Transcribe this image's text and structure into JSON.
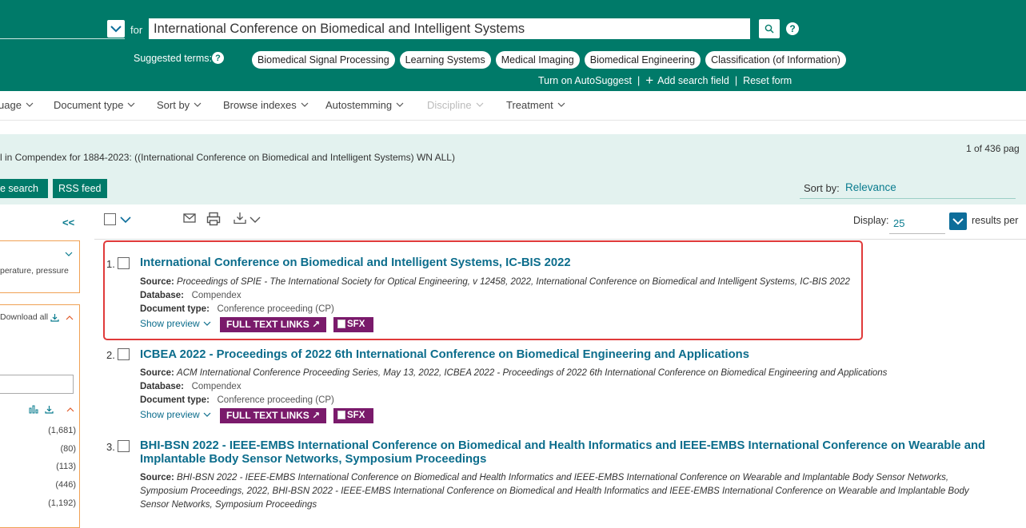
{
  "search": {
    "for_label": "for",
    "query": "International Conference on Biomedical and Intelligent Systems",
    "help_icon": "?"
  },
  "suggested": {
    "label": "Suggested terms:",
    "terms": [
      "Biomedical Signal Processing",
      "Learning Systems",
      "Medical Imaging",
      "Biomedical Engineering",
      "Classification (of Information)"
    ]
  },
  "form_links": {
    "autosuggest": "Turn on AutoSuggest",
    "add_field": "Add search field",
    "reset": "Reset form",
    "separator": "|"
  },
  "filters": [
    "uage",
    "Document type",
    "Sort by",
    "Browse indexes",
    "Autostemming",
    "Discipline",
    "Treatment"
  ],
  "results_header": {
    "query_summary": "l in Compendex for 1884-2023: ((International Conference on Biomedical and Intelligent Systems) WN ALL)",
    "page_count": "1 of 436 pag",
    "save_search": "e search",
    "rss_feed": "RSS feed",
    "sort_label": "Sort by:",
    "sort_value": "Relevance"
  },
  "sidebar": {
    "collapse": "<<",
    "panel1_text": "perature, pressure",
    "download_all": "Download all",
    "counts": [
      "(1,681)",
      "(80)",
      "(113)",
      "(446)",
      "(1,192)"
    ]
  },
  "toolbar": {
    "display_label": "Display:",
    "display_value": "25",
    "per_page": "results per"
  },
  "results": [
    {
      "num": "1.",
      "title": "International Conference on Biomedical and Intelligent Systems, IC-BIS 2022",
      "source_label": "Source:",
      "source": "Proceedings of SPIE - The International Society for Optical Engineering, v 12458, 2022, International Conference on Biomedical and Intelligent Systems, IC-BIS 2022",
      "database_label": "Database:",
      "database": "Compendex",
      "doctype_label": "Document type:",
      "doctype": "Conference proceeding (CP)",
      "preview": "Show preview",
      "ftl": "FULL TEXT LINKS",
      "sfx": "SFX"
    },
    {
      "num": "2.",
      "title": "ICBEA 2022 - Proceedings of 2022 6th International Conference on Biomedical Engineering and Applications",
      "source_label": "Source:",
      "source": "ACM International Conference Proceeding Series, May 13, 2022, ICBEA 2022 - Proceedings of 2022 6th International Conference on Biomedical Engineering and Applications",
      "database_label": "Database:",
      "database": "Compendex",
      "doctype_label": "Document type:",
      "doctype": "Conference proceeding (CP)",
      "preview": "Show preview",
      "ftl": "FULL TEXT LINKS",
      "sfx": "SFX"
    },
    {
      "num": "3.",
      "title": "BHI-BSN 2022 - IEEE-EMBS International Conference on Biomedical and Health Informatics and IEEE-EMBS International Conference on Wearable and Implantable Body Sensor Networks, Symposium Proceedings",
      "source_label": "Source:",
      "source": "BHI-BSN 2022 - IEEE-EMBS International Conference on Biomedical and Health Informatics and IEEE-EMBS International Conference on Wearable and Implantable Body Sensor Networks, Symposium Proceedings, 2022, BHI-BSN 2022 - IEEE-EMBS International Conference on Biomedical and Health Informatics and IEEE-EMBS International Conference on Wearable and Implantable Body Sensor Networks, Symposium Proceedings"
    }
  ],
  "colors": {
    "brand_green": "#007a69",
    "light_band": "#e3f2ef",
    "link_blue": "#0c6d8c",
    "fulltext_purple": "#7a1a6b",
    "highlight_red": "#e03a3a",
    "facet_orange": "#f0a154"
  },
  "icons": [
    "chevron-down-icon",
    "search-icon",
    "help-icon",
    "plus-icon",
    "email-icon",
    "print-icon",
    "download-icon",
    "chart-icon",
    "external-link-icon"
  ]
}
